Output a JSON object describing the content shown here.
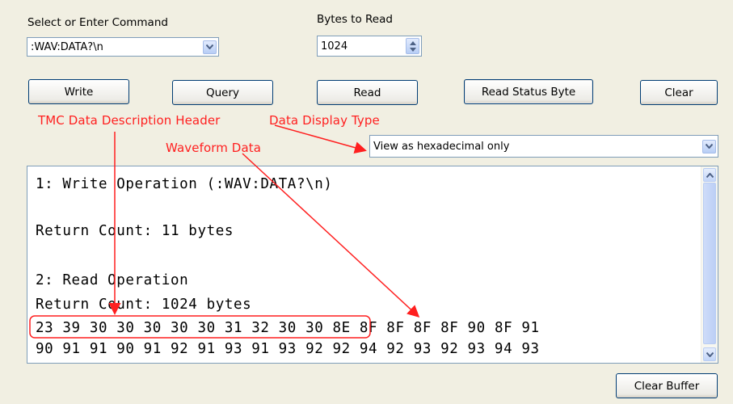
{
  "command": {
    "label": "Select or Enter Command",
    "value": ":WAV:DATA?\\n"
  },
  "bytes_to_read": {
    "label": "Bytes to Read",
    "value": "1024"
  },
  "buttons": {
    "write": "Write",
    "query": "Query",
    "read": "Read",
    "read_status_byte": "Read Status Byte",
    "clear": "Clear",
    "clear_buffer": "Clear Buffer"
  },
  "display_type": {
    "value": "View as hexadecimal only"
  },
  "annotations": {
    "tmc_header": "TMC Data Description Header",
    "display_type": "Data Display Type",
    "waveform": "Waveform Data",
    "color": "#ff1f1f"
  },
  "output": {
    "line1": "1: Write Operation (:WAV:DATA?\\n)",
    "line2": "Return Count: 11 bytes",
    "line3": "2: Read Operation",
    "line4": "Return Count: 1024 bytes",
    "header_bytes": "23 39 30 30 30 30 30 31 32 30",
    "data_bytes_1": " 30 8E 8F 8F 8F 8F 90 8F 91",
    "data_bytes_2": "90 91 91 90 91 92 91 93 91 93 92 92 94 92 93 92 93 94 93"
  },
  "icons": {
    "combo_arrow": "chevron-down-icon",
    "spin": "spin-updown-icon",
    "scroll_up": "scroll-up-icon",
    "scroll_down": "scroll-down-icon"
  }
}
